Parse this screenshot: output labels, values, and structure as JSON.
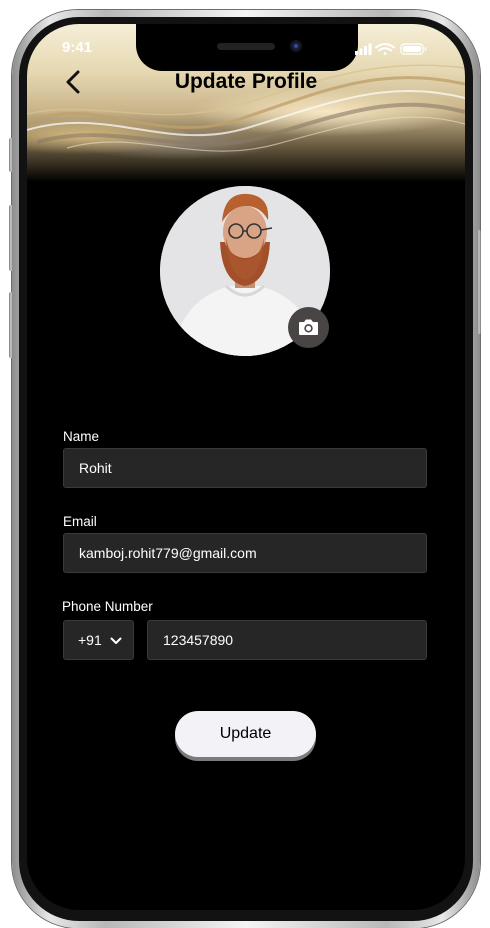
{
  "status_bar": {
    "time": "9:41"
  },
  "header": {
    "title": "Update Profile"
  },
  "form": {
    "name_label": "Name",
    "name_value": "Rohit",
    "email_label": "Email",
    "email_value": "kamboj.rohit779@gmail.com",
    "phone_label": "Phone Number",
    "country_code": "+91",
    "phone_value": "123457890"
  },
  "actions": {
    "update_label": "Update"
  },
  "icons": {
    "back": "chevron-left-icon",
    "camera": "camera-icon",
    "dropdown": "chevron-down-icon",
    "signal": "cellular-signal-icon",
    "wifi": "wifi-icon",
    "battery": "battery-icon"
  },
  "colors": {
    "screen_background": "#000000",
    "input_background": "#262626",
    "button_background": "#f2f2f7",
    "camera_button": "#4a4545"
  }
}
